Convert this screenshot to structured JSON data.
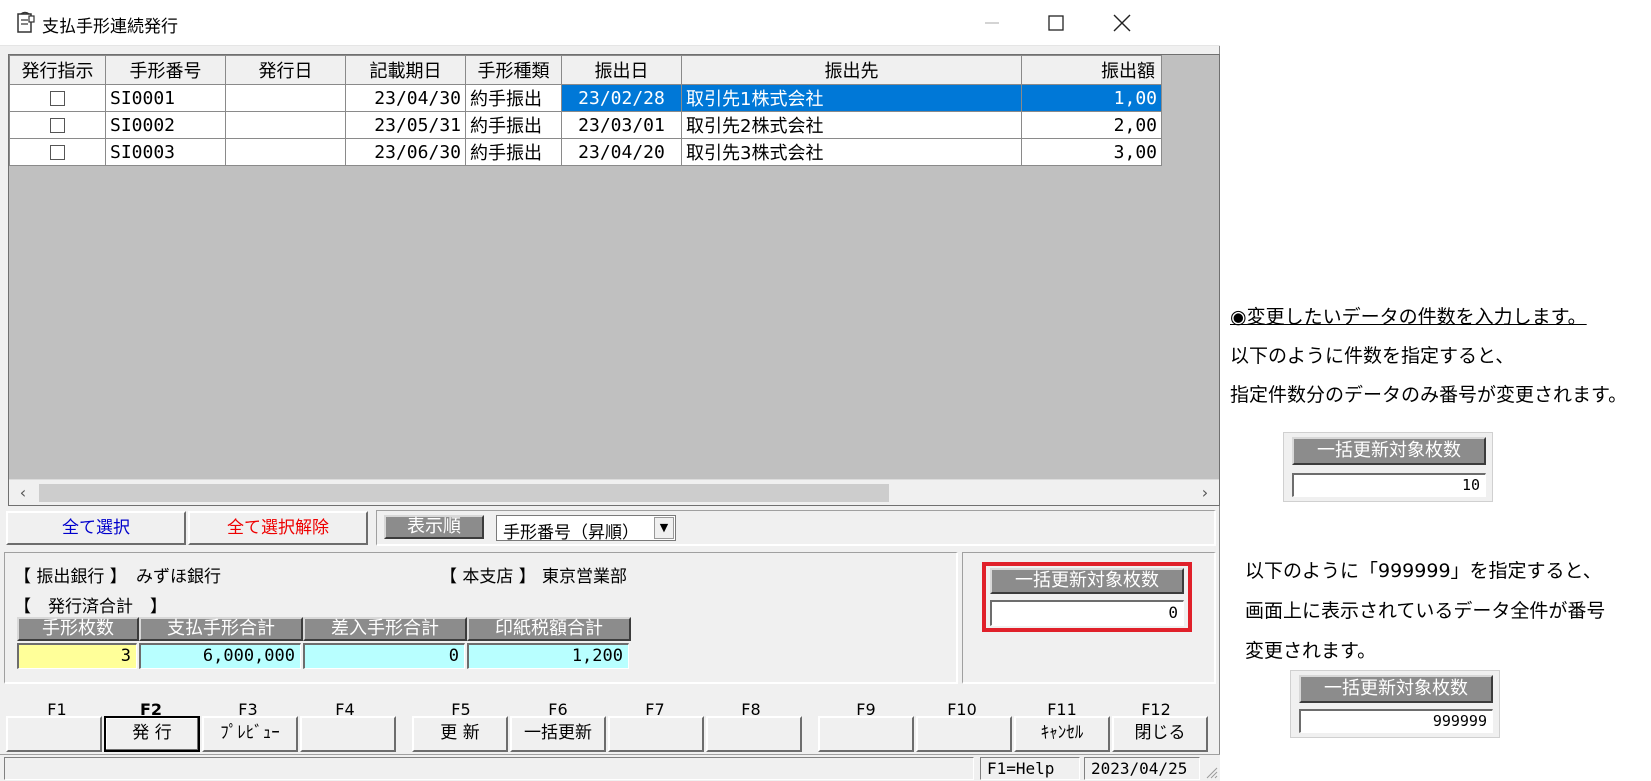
{
  "window": {
    "title": "支払手形連続発行"
  },
  "grid": {
    "columns": [
      "発行指示",
      "手形番号",
      "発行日",
      "記載期日",
      "手形種類",
      "振出日",
      "振出先",
      "振出額"
    ],
    "rows": [
      {
        "no": "SI0001",
        "issue_date": "",
        "due_date": "23/04/30",
        "kind": "約手振出",
        "draw_date": "23/02/28",
        "payee": "取引先1株式会社",
        "amount": "1,00"
      },
      {
        "no": "SI0002",
        "issue_date": "",
        "due_date": "23/05/31",
        "kind": "約手振出",
        "draw_date": "23/03/01",
        "payee": "取引先2株式会社",
        "amount": "2,00"
      },
      {
        "no": "SI0003",
        "issue_date": "",
        "due_date": "23/06/30",
        "kind": "約手振出",
        "draw_date": "23/04/20",
        "payee": "取引先3株式会社",
        "amount": "3,00"
      }
    ]
  },
  "selection": {
    "select_all": "全て選択",
    "deselect_all": "全て選択解除",
    "sort_label": "表示順",
    "sort_value": "手形番号（昇順）"
  },
  "info": {
    "bank_label": "【 振出銀行 】",
    "bank_value": "みずほ銀行",
    "branch_label": "【 本支店 】",
    "branch_value": "東京営業部",
    "issued_total_label": "【　発行済合計　】",
    "headers": [
      "手形枚数",
      "支払手形合計",
      "差入手形合計",
      "印紙税額合計"
    ],
    "values": [
      "3",
      "6,000,000",
      "0",
      "1,200"
    ]
  },
  "bulk": {
    "label": "一括更新対象枚数",
    "value": "0"
  },
  "fkeys": [
    {
      "key": "F1",
      "label": ""
    },
    {
      "key": "F2",
      "label": "発 行"
    },
    {
      "key": "F3",
      "label": "ﾌﾟﾚﾋﾞｭｰ"
    },
    {
      "key": "F4",
      "label": ""
    },
    {
      "key": "F5",
      "label": "更 新"
    },
    {
      "key": "F6",
      "label": "一括更新"
    },
    {
      "key": "F7",
      "label": ""
    },
    {
      "key": "F8",
      "label": ""
    },
    {
      "key": "F9",
      "label": ""
    },
    {
      "key": "F10",
      "label": ""
    },
    {
      "key": "F11",
      "label": "ｷｬﾝｾﾙ"
    },
    {
      "key": "F12",
      "label": "閉じる"
    }
  ],
  "status": {
    "help": "F1=Help",
    "date": "2023/04/25"
  },
  "notes": {
    "line1": "◉変更したいデータの件数を入力します。",
    "line2": "以下のように件数を指定すると、",
    "line3": "指定件数分のデータのみ番号が変更されます。",
    "sample1_label": "一括更新対象枚数",
    "sample1_value": "10",
    "line4": "以下のように「999999」を指定すると、",
    "line5": "画面上に表示されているデータ全件が番号",
    "line6": "変更されます。",
    "sample2_label": "一括更新対象枚数",
    "sample2_value": "999999"
  },
  "colors": {
    "selection": "#0078d7",
    "highlight_box": "#e0202a",
    "select_all_text": "#0000cc",
    "deselect_text": "#ee0000",
    "yellow_field": "#ffff99",
    "cyan_field": "#b8ffff"
  }
}
